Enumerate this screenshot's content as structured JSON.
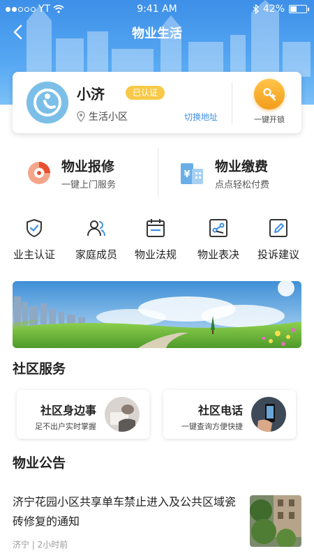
{
  "status_bar": {
    "carrier": "YT",
    "time": "9:41 AM",
    "battery": "42%",
    "battery_level": 0.42
  },
  "nav": {
    "title": "物业生活"
  },
  "profile": {
    "name": "小济",
    "badge": "已认证",
    "community": "生活小区",
    "switch_label": "切换地址",
    "unlock_label": "一键开锁"
  },
  "services": [
    {
      "title": "物业报修",
      "subtitle": "一键上门服务",
      "icon": "repair-icon"
    },
    {
      "title": "物业缴费",
      "subtitle": "点点轻松付费",
      "icon": "payment-icon"
    }
  ],
  "grid": [
    {
      "label": "业主认证",
      "icon": "shield-check-icon"
    },
    {
      "label": "家庭成员",
      "icon": "family-icon"
    },
    {
      "label": "物业法规",
      "icon": "calendar-icon"
    },
    {
      "label": "物业表决",
      "icon": "vote-icon"
    },
    {
      "label": "投诉建议",
      "icon": "edit-icon"
    }
  ],
  "community_services": {
    "title": "社区服务",
    "cards": [
      {
        "title": "社区身边事",
        "subtitle": "足不出户实时掌握"
      },
      {
        "title": "社区电话",
        "subtitle": "一键查询方便快捷"
      }
    ]
  },
  "notices": {
    "title": "物业公告",
    "items": [
      {
        "title": "济宁花园小区共享单车禁止进入及公共区域瓷砖修复的通知",
        "meta": "济宁 | 2小时前"
      }
    ]
  },
  "colors": {
    "primary": "#3d8fe8",
    "accent": "#f39c1a",
    "badge": "#f7c948"
  }
}
